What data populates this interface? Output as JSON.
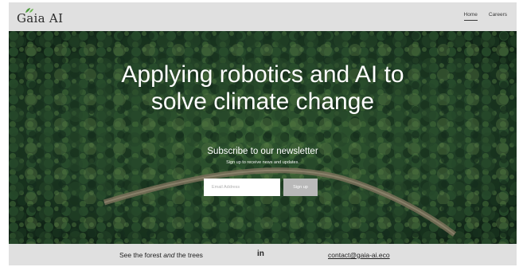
{
  "header": {
    "logo_text": "Gaia AI",
    "nav": [
      {
        "label": "Home",
        "active": true
      },
      {
        "label": "Careers",
        "active": false
      }
    ]
  },
  "hero": {
    "title_line1": "Applying robotics and AI to",
    "title_line2": "solve climate change",
    "newsletter_heading": "Subscribe to our newsletter",
    "newsletter_subtext": "Sign up to receive news and updates.",
    "email_placeholder": "Email Address",
    "signup_label": "Sign up"
  },
  "footer": {
    "tagline_before": "See the forest ",
    "tagline_emph": "and",
    "tagline_after": " the trees",
    "social_icon": "in",
    "contact_email": "contact@gaia-ai.eco"
  },
  "colors": {
    "chrome_bg": "#e0e0e0",
    "button_bg": "#b9b9b9",
    "forest_dark": "#1f3a27",
    "leaf_green": "#4a9a3a"
  }
}
